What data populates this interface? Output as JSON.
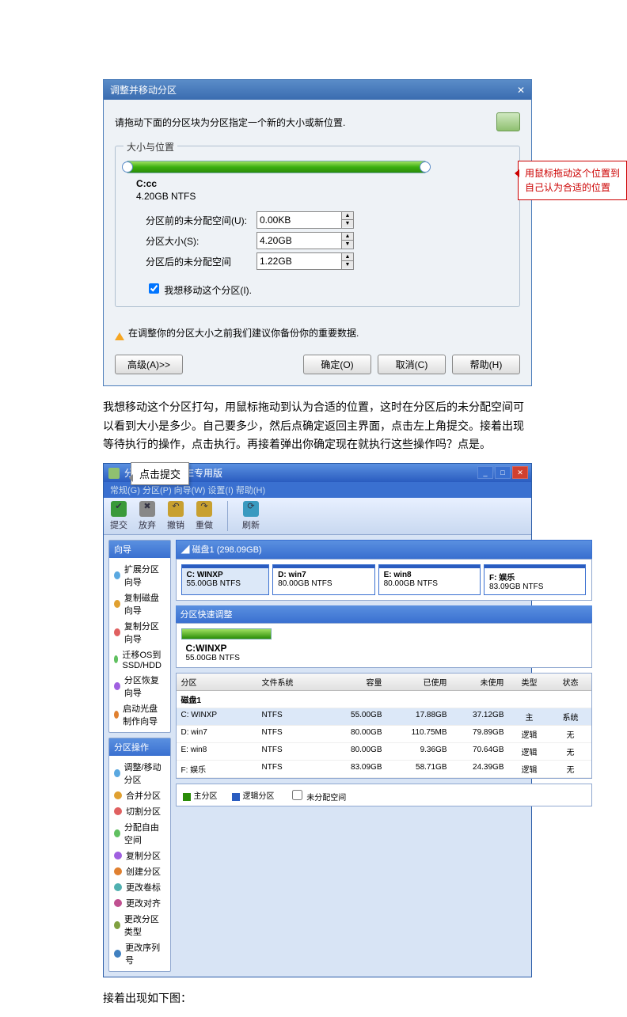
{
  "dialog": {
    "title": "调整并移动分区",
    "instruction": "请拖动下面的分区块为分区指定一个新的大小或新位置.",
    "group_legend": "大小与位置",
    "partition_name": "C:cc",
    "partition_size": "4.20GB NTFS",
    "row1_label": "分区前的未分配空间(U):",
    "row1_value": "0.00KB",
    "row2_label": "分区大小(S):",
    "row2_value": "4.20GB",
    "row3_label": "分区后的未分配空间",
    "row3_value": "1.22GB",
    "checkbox_label": "我想移动这个分区(I).",
    "warning": "在调整你的分区大小之前我们建议你备份你的重要数据.",
    "btn_adv": "高级(A)>>",
    "btn_ok": "确定(O)",
    "btn_cancel": "取消(C)",
    "btn_help": "帮助(H)",
    "callout": "用鼠标拖动这个位置到自己认为合适的位置"
  },
  "para1": "我想移动这个分区打勾，用鼠标拖动到认为合适的位置，这时在分区后的未分配空间可以看到大小是多少。自己要多少，然后点确定返回主界面，点击左上角提交。接着出现等待执行的操作，点击执行。再接着弹出你确定现在就执行这些操作吗？点是。",
  "app": {
    "title_suffix": "PE专用版",
    "tip": "点击提交",
    "menu": "常规(G)   分区(P)   向导(W)   设置(I)   帮助(H)",
    "toolbar": {
      "t1": "提交",
      "t2": "放弃",
      "t3": "撤销",
      "t4": "重做",
      "t5": "刷新"
    },
    "side1_title": "向导",
    "side1_items": [
      "扩展分区向导",
      "复制磁盘向导",
      "复制分区向导",
      "迁移OS到SSD/HDD",
      "分区恢复向导",
      "启动光盘制作向导"
    ],
    "side2_title": "分区操作",
    "side2_items": [
      "调整/移动分区",
      "合并分区",
      "切割分区",
      "分配自由空间",
      "复制分区",
      "创建分区",
      "更改卷标",
      "更改对齐",
      "更改分区类型",
      "更改序列号"
    ],
    "disk_label": "磁盘1 (298.09GB)",
    "parts": [
      {
        "name": "C: WINXP",
        "info": "55.00GB NTFS",
        "w": "22%",
        "sel": true
      },
      {
        "name": "D: win7",
        "info": "80.00GB NTFS",
        "w": "26%"
      },
      {
        "name": "E: win8",
        "info": "80.00GB NTFS",
        "w": "26%"
      },
      {
        "name": "F: 娱乐",
        "info": "83.09GB NTFS",
        "w": "26%"
      }
    ],
    "quick_title": "分区快速调整",
    "quick_name": "C:WINXP",
    "quick_info": "55.00GB NTFS",
    "cols": {
      "c1": "分区",
      "c2": "文件系统",
      "c3": "容量",
      "c4": "已使用",
      "c5": "未使用",
      "c6": "类型",
      "c7": "状态"
    },
    "group_row": "磁盘1",
    "rows": [
      {
        "c1": "C: WINXP",
        "c2": "NTFS",
        "c3": "55.00GB",
        "c4": "17.88GB",
        "c5": "37.12GB",
        "c6": "主",
        "c7": "系统",
        "sel": true
      },
      {
        "c1": "D: win7",
        "c2": "NTFS",
        "c3": "80.00GB",
        "c4": "110.75MB",
        "c5": "79.89GB",
        "c6": "逻辑",
        "c7": "无"
      },
      {
        "c1": "E: win8",
        "c2": "NTFS",
        "c3": "80.00GB",
        "c4": "9.36GB",
        "c5": "70.64GB",
        "c6": "逻辑",
        "c7": "无"
      },
      {
        "c1": "F: 娱乐",
        "c2": "NTFS",
        "c3": "83.09GB",
        "c4": "58.71GB",
        "c5": "24.39GB",
        "c6": "逻辑",
        "c7": "无"
      }
    ],
    "legend": {
      "a": "主分区",
      "b": "逻辑分区",
      "c": "未分配空间"
    }
  },
  "para2": "接着出现如下图："
}
